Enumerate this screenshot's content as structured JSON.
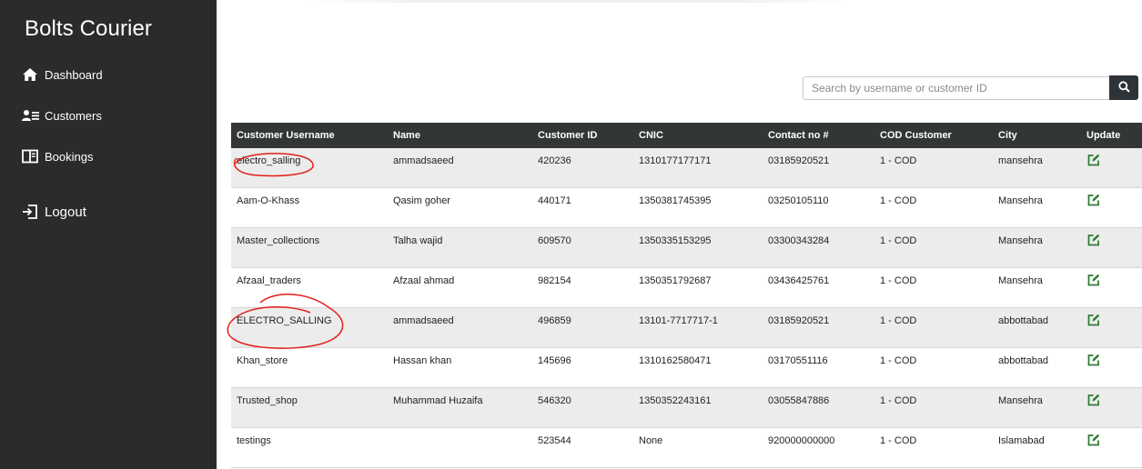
{
  "sidebar": {
    "brand": "Bolts Courier",
    "items": [
      {
        "label": "Dashboard",
        "icon": "home-icon"
      },
      {
        "label": "Customers",
        "icon": "user-list-icon"
      },
      {
        "label": "Bookings",
        "icon": "book-icon"
      }
    ],
    "logout": {
      "label": "Logout",
      "icon": "logout-icon"
    }
  },
  "search": {
    "placeholder": "Search by username or customer ID",
    "value": "",
    "icon": "search-icon"
  },
  "table": {
    "headers": [
      "Customer Username",
      "Name",
      "Customer ID",
      "CNIC",
      "Contact no #",
      "COD Customer",
      "City",
      "Update"
    ],
    "rows": [
      {
        "username": "electro_salling",
        "name": "ammadsaeed",
        "customer_id": "420236",
        "cnic": "1310177177171",
        "contact": "03185920521",
        "cod": "1 - COD",
        "city": "mansehra"
      },
      {
        "username": "Aam-O-Khass",
        "name": "Qasim goher",
        "customer_id": "440171",
        "cnic": "1350381745395",
        "contact": "03250105110",
        "cod": "1 - COD",
        "city": "Mansehra"
      },
      {
        "username": "Master_collections",
        "name": "Talha wajid",
        "customer_id": "609570",
        "cnic": "1350335153295",
        "contact": "03300343284",
        "cod": "1 - COD",
        "city": "Mansehra"
      },
      {
        "username": "Afzaal_traders",
        "name": "Afzaal ahmad",
        "customer_id": "982154",
        "cnic": "1350351792687",
        "contact": "03436425761",
        "cod": "1 - COD",
        "city": "Mansehra"
      },
      {
        "username": "ELECTRO_SALLING",
        "name": "ammadsaeed",
        "customer_id": "496859",
        "cnic": "13101-7717717-1",
        "contact": "03185920521",
        "cod": "1 - COD",
        "city": "abbottabad"
      },
      {
        "username": "Khan_store",
        "name": "Hassan khan",
        "customer_id": "145696",
        "cnic": "1310162580471",
        "contact": "03170551116",
        "cod": "1 - COD",
        "city": "abbottabad"
      },
      {
        "username": "Trusted_shop",
        "name": "Muhammad Huzaifa",
        "customer_id": "546320",
        "cnic": "1350352243161",
        "contact": "03055847886",
        "cod": "1 - COD",
        "city": "Mansehra"
      },
      {
        "username": "testings",
        "name": "",
        "customer_id": "523544",
        "cnic": "None",
        "contact": "920000000000",
        "cod": "1 - COD",
        "city": "Islamabad"
      }
    ],
    "update_icon": "edit-icon"
  },
  "colors": {
    "sidebar_bg": "#2b2b2b",
    "table_header_bg": "#333637",
    "row_alt_bg": "#ececec",
    "edit_icon": "#2e7d32",
    "annotation": "#e0201b"
  }
}
